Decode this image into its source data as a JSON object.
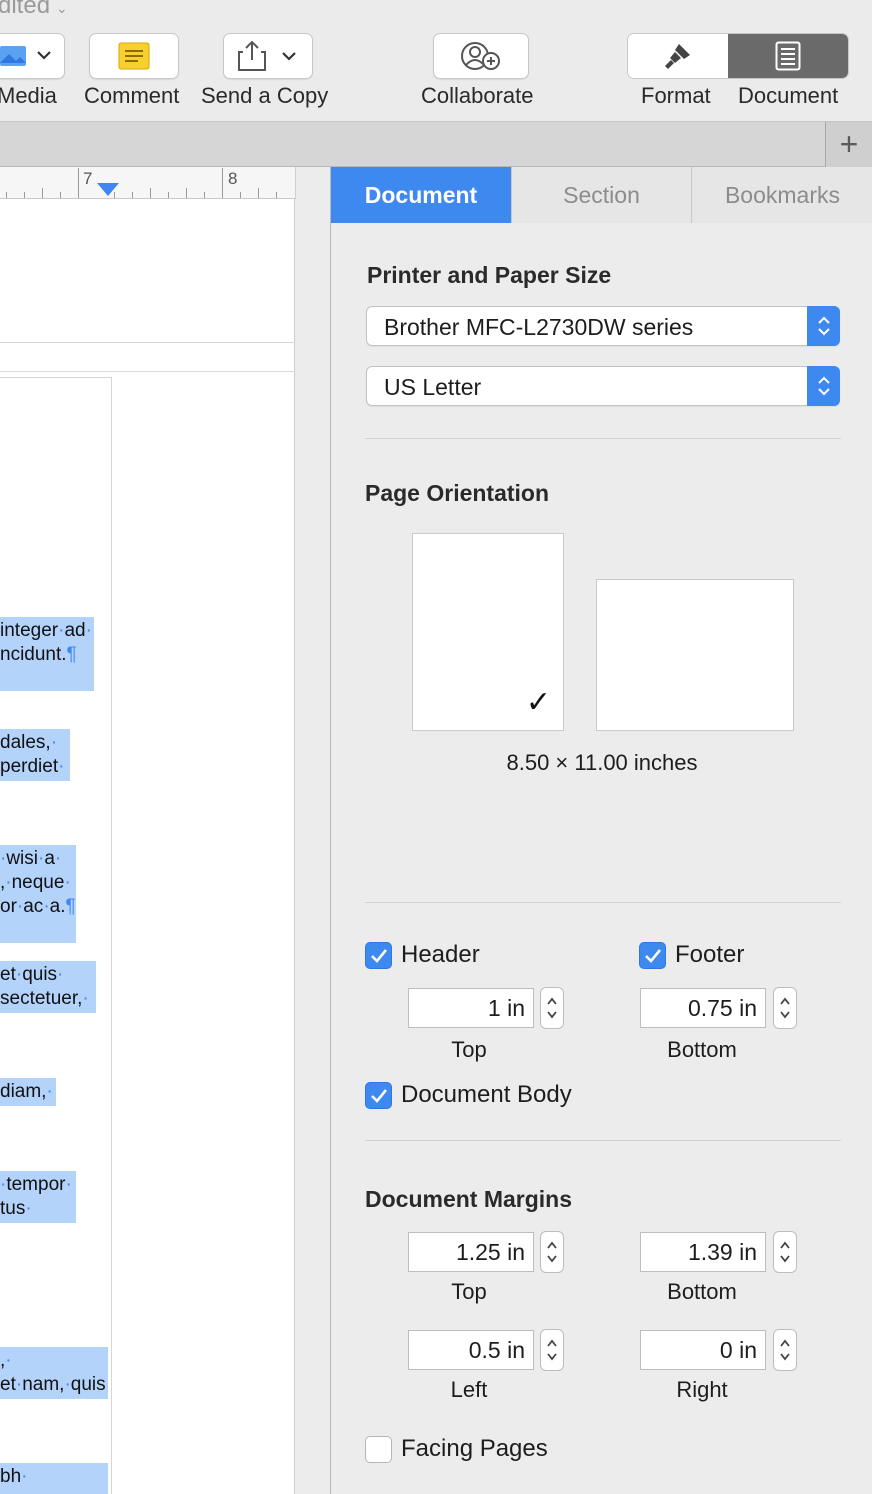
{
  "window": {
    "title_fragment": "dited"
  },
  "toolbar": {
    "media_label": "Media",
    "comment_label": "Comment",
    "send_copy_label": "Send a Copy",
    "collaborate_label": "Collaborate",
    "format_label": "Format",
    "document_label": "Document",
    "add_page_glyph": "+"
  },
  "ruler": {
    "marks": [
      "7",
      "8"
    ]
  },
  "document_text": {
    "lines": [
      "integer·ad·",
      "ncidunt.¶",
      "dales,·",
      "perdiet·",
      "·wisi·a·",
      ",·neque·",
      "or·ac·a.¶",
      "et·quis·",
      "sectetuer,·",
      "diam,·",
      "·tempor·",
      "tus·",
      ",·",
      "et·nam,·quis",
      "bh·"
    ]
  },
  "inspector": {
    "tabs": [
      "Document",
      "Section",
      "Bookmarks"
    ],
    "active_tab": "Document",
    "printer_section_title": "Printer and Paper Size",
    "printer": "Brother MFC-L2730DW series",
    "paper_size": "US Letter",
    "orientation_title": "Page Orientation",
    "orientation_selected": "portrait",
    "page_dimensions": "8.50 × 11.00 inches",
    "header": {
      "label": "Header",
      "checked": true,
      "value": "1 in",
      "caption": "Top"
    },
    "footer": {
      "label": "Footer",
      "checked": true,
      "value": "0.75 in",
      "caption": "Bottom"
    },
    "document_body": {
      "label": "Document Body",
      "checked": true
    },
    "margins_title": "Document Margins",
    "margins": {
      "top": {
        "value": "1.25 in",
        "caption": "Top"
      },
      "bottom": {
        "value": "1.39 in",
        "caption": "Bottom"
      },
      "left": {
        "value": "0.5 in",
        "caption": "Left"
      },
      "right": {
        "value": "0 in",
        "caption": "Right"
      }
    },
    "facing_pages": {
      "label": "Facing Pages",
      "checked": false
    }
  },
  "colors": {
    "accent": "#3d89f0",
    "selection": "#b4d3fb"
  }
}
